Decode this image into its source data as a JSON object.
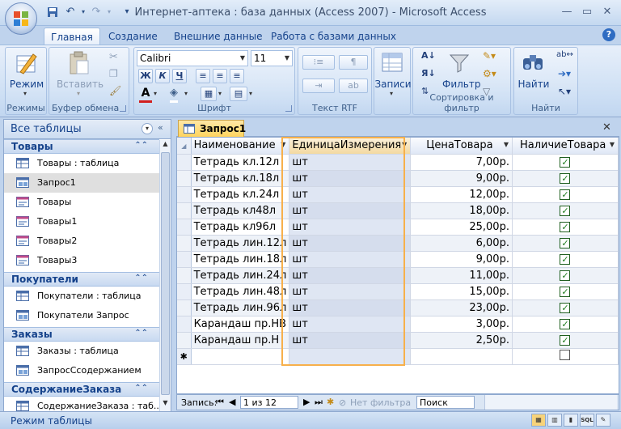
{
  "window": {
    "title": "Интернет-аптека : база данных (Access 2007)  -  Microsoft Access",
    "qat_icons": [
      "save-icon",
      "undo-icon",
      "redo-icon",
      "customize-icon"
    ]
  },
  "ribbon": {
    "tabs": [
      {
        "label": "Главная",
        "active": true
      },
      {
        "label": "Создание",
        "active": false
      },
      {
        "label": "Внешние данные",
        "active": false
      },
      {
        "label": "Работа с базами данных",
        "active": false
      }
    ],
    "help": "?",
    "groups": {
      "views": {
        "label": "Режимы",
        "button": "Режим"
      },
      "clipboard": {
        "label": "Буфер обмена",
        "paste": "Вставить"
      },
      "font": {
        "label": "Шрифт",
        "font_name": "Calibri",
        "font_size": "11",
        "bold": "Ж",
        "italic": "К",
        "underline": "Ч",
        "font_color": "A"
      },
      "rtf": {
        "label": "Текст RTF"
      },
      "records": {
        "label": "",
        "button": "Записи"
      },
      "sortfilter": {
        "label": "Сортировка и фильтр",
        "filter": "Фильтр"
      },
      "find": {
        "label": "Найти",
        "button": "Найти"
      }
    }
  },
  "nav": {
    "header": "Все таблицы",
    "groups": [
      {
        "label": "Товары",
        "items": [
          {
            "label": "Товары : таблица",
            "icon": "table-icon"
          },
          {
            "label": "Запрос1",
            "icon": "query-icon",
            "selected": true
          },
          {
            "label": "Товары",
            "icon": "form-icon"
          },
          {
            "label": "Товары1",
            "icon": "form-icon"
          },
          {
            "label": "Товары2",
            "icon": "form-icon"
          },
          {
            "label": "Товары3",
            "icon": "form-icon"
          }
        ]
      },
      {
        "label": "Покупатели",
        "items": [
          {
            "label": "Покупатели : таблица",
            "icon": "table-icon"
          },
          {
            "label": "Покупатели Запрос",
            "icon": "query-icon"
          }
        ]
      },
      {
        "label": "Заказы",
        "items": [
          {
            "label": "Заказы : таблица",
            "icon": "table-icon"
          },
          {
            "label": "ЗапросСсодержанием",
            "icon": "query-icon"
          }
        ]
      },
      {
        "label": "СодержаниеЗаказа",
        "items": [
          {
            "label": "СодержаниеЗаказа : таб...",
            "icon": "table-icon"
          }
        ]
      }
    ]
  },
  "document": {
    "tab_label": "Запрос1",
    "columns": [
      "Наименование",
      "ЕдиницаИзмерения",
      "ЦенаТовара",
      "НаличиеТовара"
    ],
    "rows": [
      {
        "name": "Тетрадь кл.12л",
        "unit": "шт",
        "price": "7,00р.",
        "in_stock": true
      },
      {
        "name": "Тетрадь кл.18л",
        "unit": "шт",
        "price": "9,00р.",
        "in_stock": true
      },
      {
        "name": "Тетрадь кл.24л",
        "unit": "шт",
        "price": "12,00р.",
        "in_stock": true
      },
      {
        "name": "Тетрадь кл48л",
        "unit": "шт",
        "price": "18,00р.",
        "in_stock": true
      },
      {
        "name": "Тетрадь кл96л",
        "unit": "шт",
        "price": "25,00р.",
        "in_stock": true
      },
      {
        "name": "Тетрадь лин.12л",
        "unit": "шт",
        "price": "6,00р.",
        "in_stock": true
      },
      {
        "name": "Тетрадь лин.18л",
        "unit": "шт",
        "price": "9,00р.",
        "in_stock": true
      },
      {
        "name": "Тетрадь лин.24л",
        "unit": "шт",
        "price": "11,00р.",
        "in_stock": true
      },
      {
        "name": "Тетрадь лин.48л",
        "unit": "шт",
        "price": "15,00р.",
        "in_stock": true
      },
      {
        "name": "Тетрадь лин.96л",
        "unit": "шт",
        "price": "23,00р.",
        "in_stock": true
      },
      {
        "name": "Карандаш пр.НВ",
        "unit": "шт",
        "price": "3,00р.",
        "in_stock": true
      },
      {
        "name": "Карандаш пр.Н",
        "unit": "шт",
        "price": "2,50р.",
        "in_stock": true
      }
    ],
    "new_row_marker": "✱",
    "record_nav": {
      "label": "Запись:",
      "position": "1 из 12",
      "filter": "Нет фильтра",
      "search": "Поиск"
    }
  },
  "status": {
    "text": "Режим таблицы"
  },
  "colors": {
    "accent": "#15428b",
    "highlight": "#f7b04b",
    "tab": "#ffd35a"
  }
}
